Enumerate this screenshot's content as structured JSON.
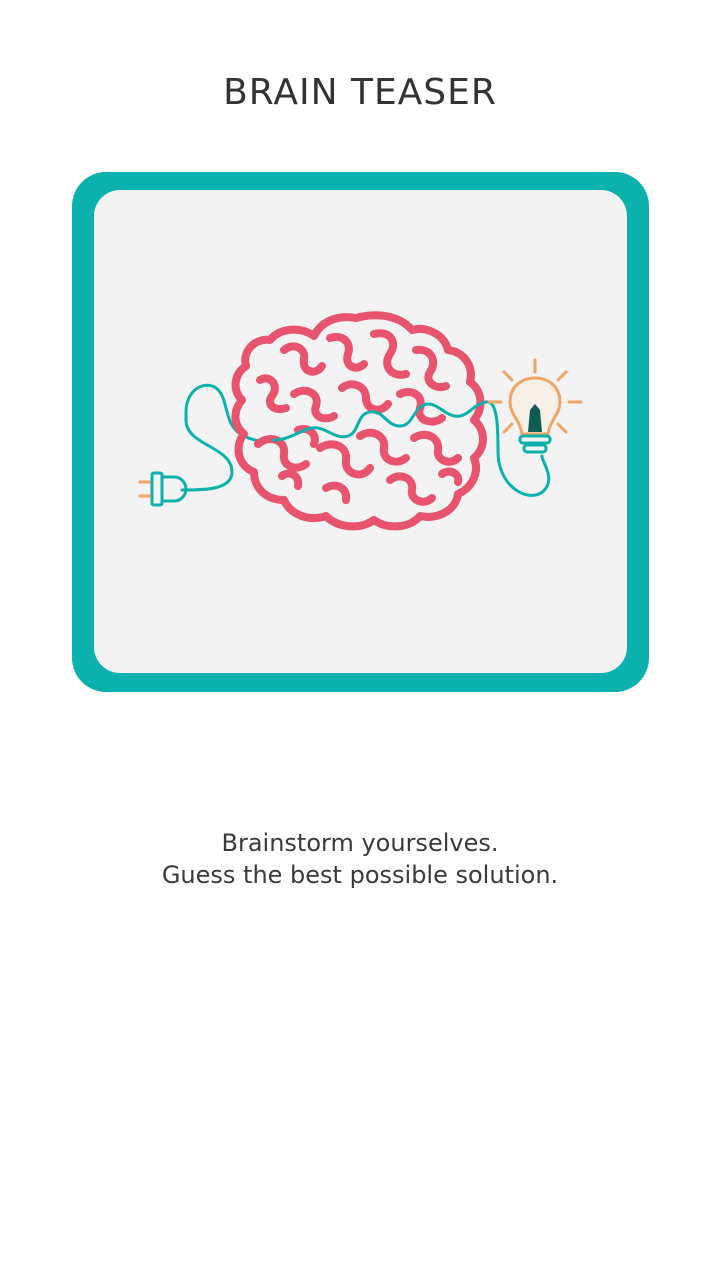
{
  "header": {
    "title": "BRAIN TEASER"
  },
  "card": {
    "frame_color": "#0ab1ad",
    "background_color": "#f3f3f3",
    "illustration": {
      "icons": [
        "brain-maze-icon",
        "power-plug-icon",
        "light-bulb-icon"
      ],
      "colors": {
        "brain": "#e8536e",
        "wire": "#0ab1ad",
        "bulb": "#f2a365",
        "filament": "#0e5c52"
      }
    }
  },
  "description": {
    "line1": "Brainstorm yourselves.",
    "line2": "Guess the best possible solution."
  }
}
